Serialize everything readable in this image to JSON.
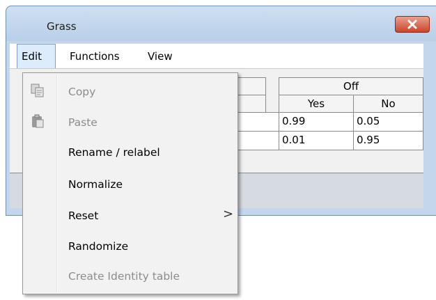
{
  "window": {
    "title": "Grass"
  },
  "menubar": {
    "edit": "Edit",
    "functions": "Functions",
    "view": "View"
  },
  "table": {
    "group_header": "Off",
    "col_headers": [
      "No",
      "Yes",
      "No"
    ],
    "rows": [
      [
        "0.99",
        "0.05"
      ],
      [
        "0.01",
        "0.95"
      ]
    ]
  },
  "edit_menu": {
    "items": [
      {
        "label": "Copy",
        "enabled": false,
        "icon": "copy-icon"
      },
      {
        "label": "Paste",
        "enabled": false,
        "icon": "paste-icon"
      },
      {
        "label": "Rename / relabel",
        "enabled": true
      },
      {
        "label": "Normalize",
        "enabled": true
      },
      {
        "label": "Reset",
        "enabled": true,
        "submenu": true
      },
      {
        "label": "Randomize",
        "enabled": true
      },
      {
        "label": "Create Identity table",
        "enabled": false
      }
    ],
    "submenu_arrow": ">"
  },
  "colors": {
    "title_bar": "#c3d6ec",
    "close_button": "#c9452a",
    "menu_highlight": "#dcecfc",
    "disabled_text": "#8c8c8c"
  }
}
